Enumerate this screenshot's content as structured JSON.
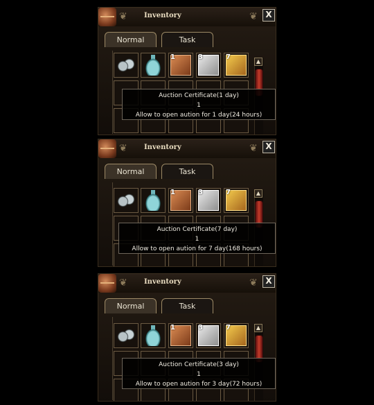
{
  "panels": [
    {
      "title": "Inventory",
      "tabs": {
        "normal": "Normal",
        "task": "Task"
      },
      "close_label": "X",
      "slots": [
        {
          "icon": "coins-icon",
          "count": ""
        },
        {
          "icon": "vase-icon",
          "count": ""
        },
        {
          "icon": "auction-certificate-1-day-icon",
          "count": "1"
        },
        {
          "icon": "auction-certificate-3-day-icon",
          "count": "3"
        },
        {
          "icon": "auction-certificate-7-day-icon",
          "count": "7"
        }
      ],
      "tooltip": {
        "name": "Auction Certificate(1 day)",
        "quantity": "1",
        "description": "Allow to open aution for 1 day(24 hours)"
      }
    },
    {
      "title": "Inventory",
      "tabs": {
        "normal": "Normal",
        "task": "Task"
      },
      "close_label": "X",
      "slots": [
        {
          "icon": "coins-icon",
          "count": ""
        },
        {
          "icon": "vase-icon",
          "count": ""
        },
        {
          "icon": "auction-certificate-1-day-icon",
          "count": "1"
        },
        {
          "icon": "auction-certificate-3-day-icon",
          "count": "3"
        },
        {
          "icon": "auction-certificate-7-day-icon",
          "count": "7"
        }
      ],
      "tooltip": {
        "name": "Auction Certificate(7 day)",
        "quantity": "1",
        "description": "Allow to open aution for 7 day(168 hours)"
      }
    },
    {
      "title": "Inventory",
      "tabs": {
        "normal": "Normal",
        "task": "Task"
      },
      "close_label": "X",
      "slots": [
        {
          "icon": "coins-icon",
          "count": ""
        },
        {
          "icon": "vase-icon",
          "count": ""
        },
        {
          "icon": "auction-certificate-1-day-icon",
          "count": "1"
        },
        {
          "icon": "auction-certificate-3-day-icon",
          "count": "3"
        },
        {
          "icon": "auction-certificate-7-day-icon",
          "count": "7"
        }
      ],
      "tooltip": {
        "name": "Auction Certificate(3 day)",
        "quantity": "1",
        "description": "Allow to open aution for 3 day(72 hours)"
      }
    }
  ],
  "colors": {
    "accent_red": "#c53b2a",
    "frame_gold": "#9d8a66",
    "text_light": "#f1ede3"
  }
}
